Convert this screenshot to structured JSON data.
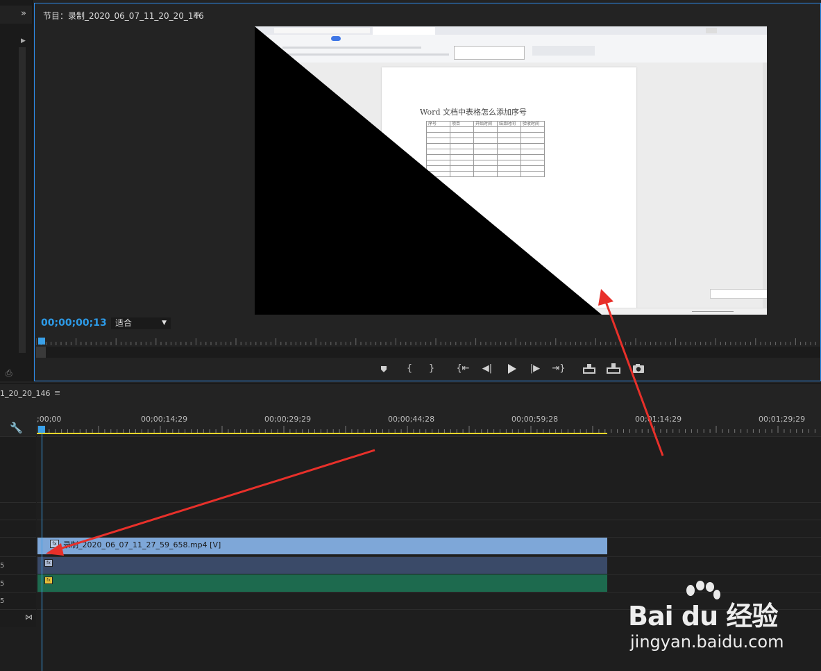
{
  "program_monitor": {
    "title": "节目：录制_2020_06_07_11_20_20_146",
    "menu_glyph": "≡",
    "expand_glyph": "»",
    "timecode": "00;00;00;13",
    "fit": "适合",
    "video": {
      "doc_title": "Word 文档中表格怎么添加序号",
      "table_headers": [
        "序号",
        "项目",
        "开始时间",
        "结束时间",
        "验收时间"
      ],
      "table_empty_rows": 9
    },
    "transport_icons": [
      "marker-icon",
      "mark-in-icon",
      "mark-out-icon",
      "go-to-in-icon",
      "step-back-icon",
      "play-icon",
      "step-forward-icon",
      "go-to-out-icon",
      "lift-icon",
      "extract-icon",
      "export-frame-icon"
    ]
  },
  "timeline": {
    "tab": "1_20_20_146",
    "menu_glyph": "≡",
    "ticks": [
      ";00;00",
      "00;00;14;29",
      "00;00;29;29",
      "00;00;44;28",
      "00;00;59;28",
      "00;01;14;29",
      "00;01;29;29"
    ],
    "tracks": [
      {
        "label": ""
      },
      {
        "label": ""
      },
      {
        "label": ""
      },
      {
        "label": ""
      },
      {
        "label": "5"
      },
      {
        "label": "5"
      },
      {
        "label": "5"
      }
    ],
    "clip_v1": {
      "fx": "fx",
      "name": "录制_2020_06_07_11_27_59_658.mp4 [V]"
    },
    "clip_a1": {
      "fx": "fx"
    },
    "clip_a2": {
      "fx": "fx"
    }
  },
  "watermark": {
    "brand": "Bai du 经验",
    "url": "jingyan.baidu.com"
  },
  "colors": {
    "accent": "#2d8ceb",
    "timecode": "#2d9be8",
    "video_clip": "#7ea7d8",
    "audio_clip_1": "#3a4a68",
    "audio_clip_2": "#1d6a4e",
    "work_area": "#e8d62a",
    "arrow": "#e8302a"
  }
}
